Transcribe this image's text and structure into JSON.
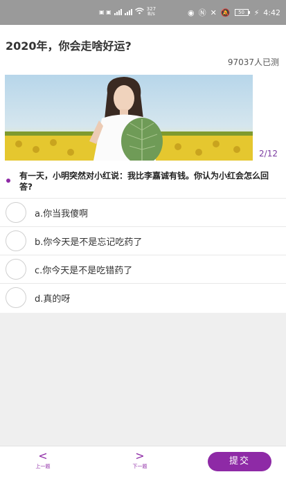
{
  "status_bar": {
    "net_speed_value": "327",
    "net_speed_unit": "B/s",
    "battery": "50",
    "time": "4:42"
  },
  "quiz": {
    "title": "2020年，你会走啥好运?",
    "participants": "97037人已测",
    "progress": "2/12",
    "question": "有一天，小明突然对小红说：我比李嘉诚有钱。你认为小红会怎么回答?",
    "options": [
      {
        "label": "a.你当我傻啊"
      },
      {
        "label": "b.你今天是不是忘记吃药了"
      },
      {
        "label": "c.你今天是不是吃错药了"
      },
      {
        "label": "d.真的呀"
      }
    ]
  },
  "bottom_bar": {
    "prev_label": "上一题",
    "next_label": "下一题",
    "submit_label": "提交"
  },
  "colors": {
    "accent": "#8e2aa6",
    "status_bar_bg": "#9a9a9a"
  }
}
